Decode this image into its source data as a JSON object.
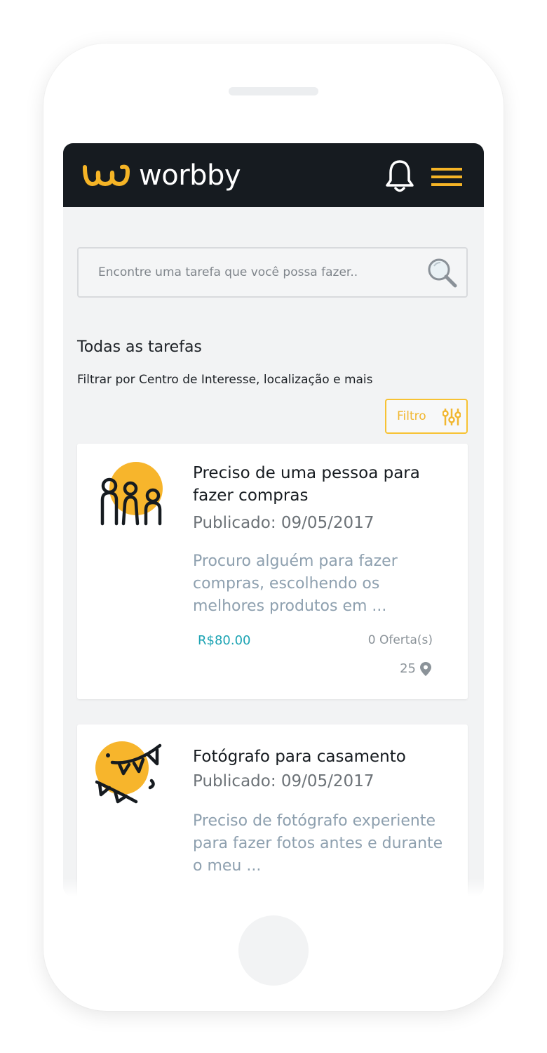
{
  "header": {
    "brand": "worbby",
    "colors": {
      "bar": "#161b20",
      "accent": "#f5b426"
    },
    "icons": [
      "logo-mark-icon",
      "bell-icon",
      "hamburger-menu-icon"
    ]
  },
  "search": {
    "placeholder": "Encontre uma tarefa que você possa fazer..",
    "icon": "search-icon"
  },
  "section": {
    "title": "Todas as tarefas",
    "subtitle": "Filtrar por Centro de Interesse, localização e mais"
  },
  "filter": {
    "label": "Filtro",
    "icon": "sliders-icon"
  },
  "tasks": [
    {
      "title": "Preciso de uma pessoa para fazer compras",
      "date": "Publicado: 09/05/2017",
      "description": "Procuro alguém para fazer compras, escolhendo os melhores produtos em ...",
      "price": "R$80.00",
      "offers": "0 Oferta(s)",
      "distance": "25",
      "icon": "people-group-icon"
    },
    {
      "title": "Fotógrafo para casamento",
      "date": "Publicado: 09/05/2017",
      "description": "Preciso de fotógrafo experiente para fazer fotos antes e durante o meu ...",
      "icon": "party-bunting-icon"
    }
  ]
}
